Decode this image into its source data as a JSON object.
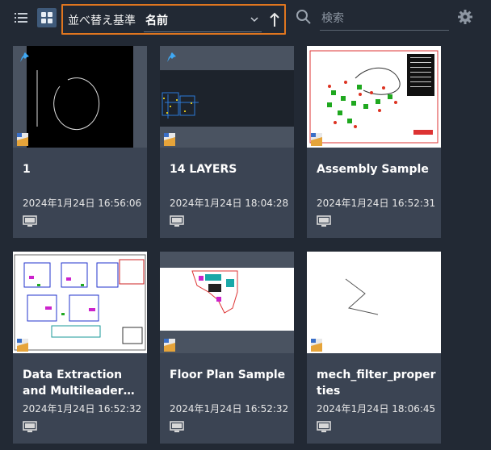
{
  "toolbar": {
    "sort_label": "並べ替え基準",
    "sort_value": "名前",
    "search_placeholder": "検索",
    "icons": [
      "list-view-icon",
      "grid-view-icon",
      "chevron-down-icon",
      "sort-ascending-icon",
      "search-icon",
      "gear-icon"
    ]
  },
  "colors": {
    "background": "#222934",
    "card": "#3b4453",
    "highlight_border": "#e0761f",
    "pin": "#3fa9f5"
  },
  "drawings": [
    {
      "title": "1",
      "date": "2024年1月24日 16:56:06",
      "pinned": true
    },
    {
      "title": "14 LAYERS",
      "date": "2024年1月24日 18:04:28",
      "pinned": true
    },
    {
      "title": "Assembly Sample",
      "date": "2024年1月24日 16:52:31",
      "pinned": false
    },
    {
      "title": "Data Extraction and Multileader…",
      "date": "2024年1月24日 16:52:32",
      "pinned": false
    },
    {
      "title": "Floor Plan Sample",
      "date": "2024年1月24日 16:52:32",
      "pinned": false
    },
    {
      "title": "mech_filter_properties",
      "date": "2024年1月24日 18:06:45",
      "pinned": false
    }
  ]
}
